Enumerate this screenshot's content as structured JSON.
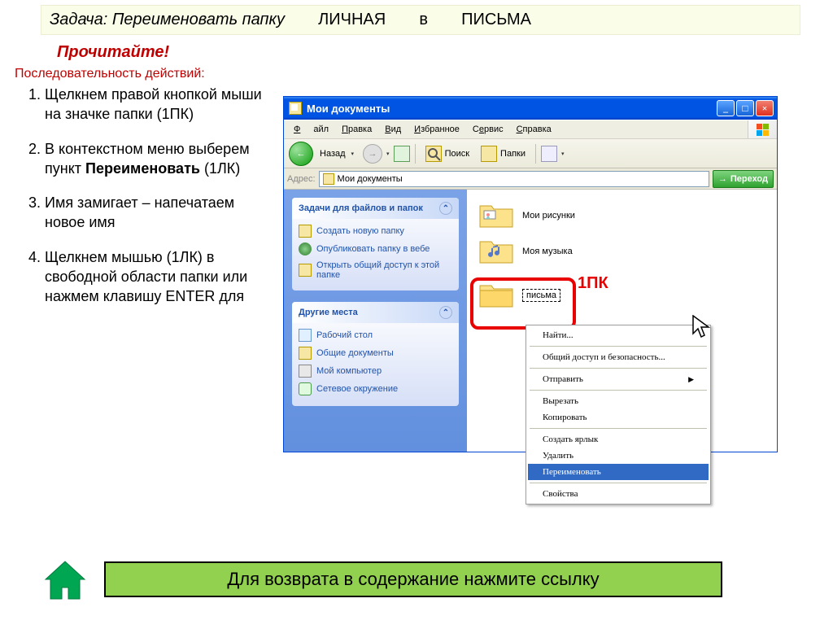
{
  "task_line": {
    "label": "Задача:",
    "text": "Переименовать папку",
    "arg1": "ЛИЧНАЯ",
    "mid": "в",
    "arg2": "ПИСЬМА"
  },
  "read_heading": "Прочитайте!",
  "sequence_label": "Последовательность действий:",
  "steps": [
    "Щелкнем правой кнопкой мыши на значке папки (1ПК)",
    "В контекстном меню выберем пункт ",
    "Имя замигает – напечатаем  новое имя",
    "Щелкнем мышью (1ЛК) в свободной области папки или нажмем клавишу ENTER для"
  ],
  "step2_bold": "Переименовать",
  "step2_tail": " (1ЛК)",
  "window": {
    "title": "Мои документы",
    "menu": {
      "file": "Файл",
      "edit": "Правка",
      "view": "Вид",
      "fav": "Избранное",
      "tools": "Сервис",
      "help": "Справка"
    },
    "toolbar": {
      "back": "Назад",
      "search": "Поиск",
      "folders": "Папки"
    },
    "address_label": "Адрес:",
    "address_value": "Мои документы",
    "go_label": "Переход",
    "panel_tasks": {
      "title": "Задачи для файлов и папок",
      "new_folder": "Создать новую папку",
      "publish": "Опубликовать папку в вебе",
      "share": "Открыть общий доступ к этой папке"
    },
    "panel_places": {
      "title": "Другие места",
      "desktop": "Рабочий стол",
      "shared": "Общие документы",
      "computer": "Мой компьютер",
      "network": "Сетевое окружение"
    },
    "files": {
      "pictures": "Мои рисунки",
      "music": "Моя музыка",
      "letters": "письма"
    },
    "onepk": "1ПК"
  },
  "context_menu": {
    "find": "Найти...",
    "share_sec": "Общий доступ и безопасность...",
    "send": "Отправить",
    "cut": "Вырезать",
    "copy": "Копировать",
    "shortcut": "Создать ярлык",
    "delete": "Удалить",
    "rename": "Переименовать",
    "props": "Свойства"
  },
  "bottom": "Для возврата в содержание нажмите ссылку"
}
